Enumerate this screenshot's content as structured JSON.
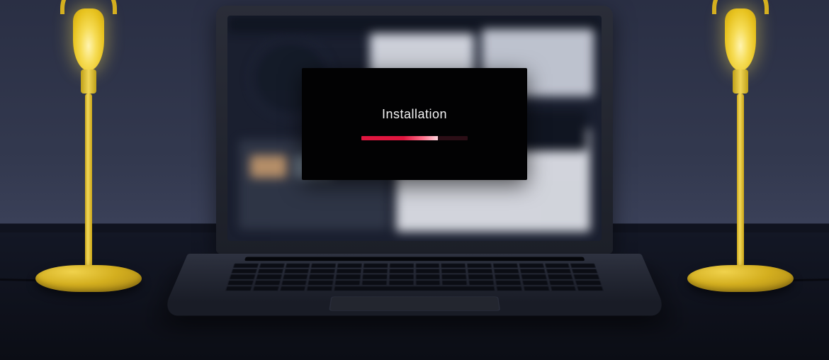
{
  "installer": {
    "title": "Installation",
    "progress_percent": 72
  },
  "colors": {
    "progress_accent": "#e0163f"
  }
}
